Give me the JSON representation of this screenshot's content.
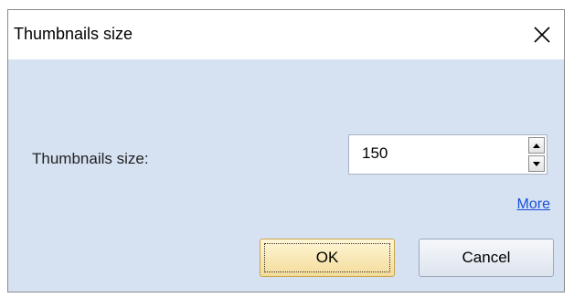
{
  "window": {
    "title": "Thumbnails size",
    "close_icon": "close-icon"
  },
  "form": {
    "label": "Thumbnails size:",
    "value": "150",
    "spin_up_icon": "triangle-up-icon",
    "spin_down_icon": "triangle-down-icon"
  },
  "links": {
    "more": "More"
  },
  "buttons": {
    "ok": "OK",
    "cancel": "Cancel"
  },
  "colors": {
    "client_background": "#d6e2f2",
    "link": "#1a4fd6",
    "ok_button": "#f3dc9a"
  }
}
